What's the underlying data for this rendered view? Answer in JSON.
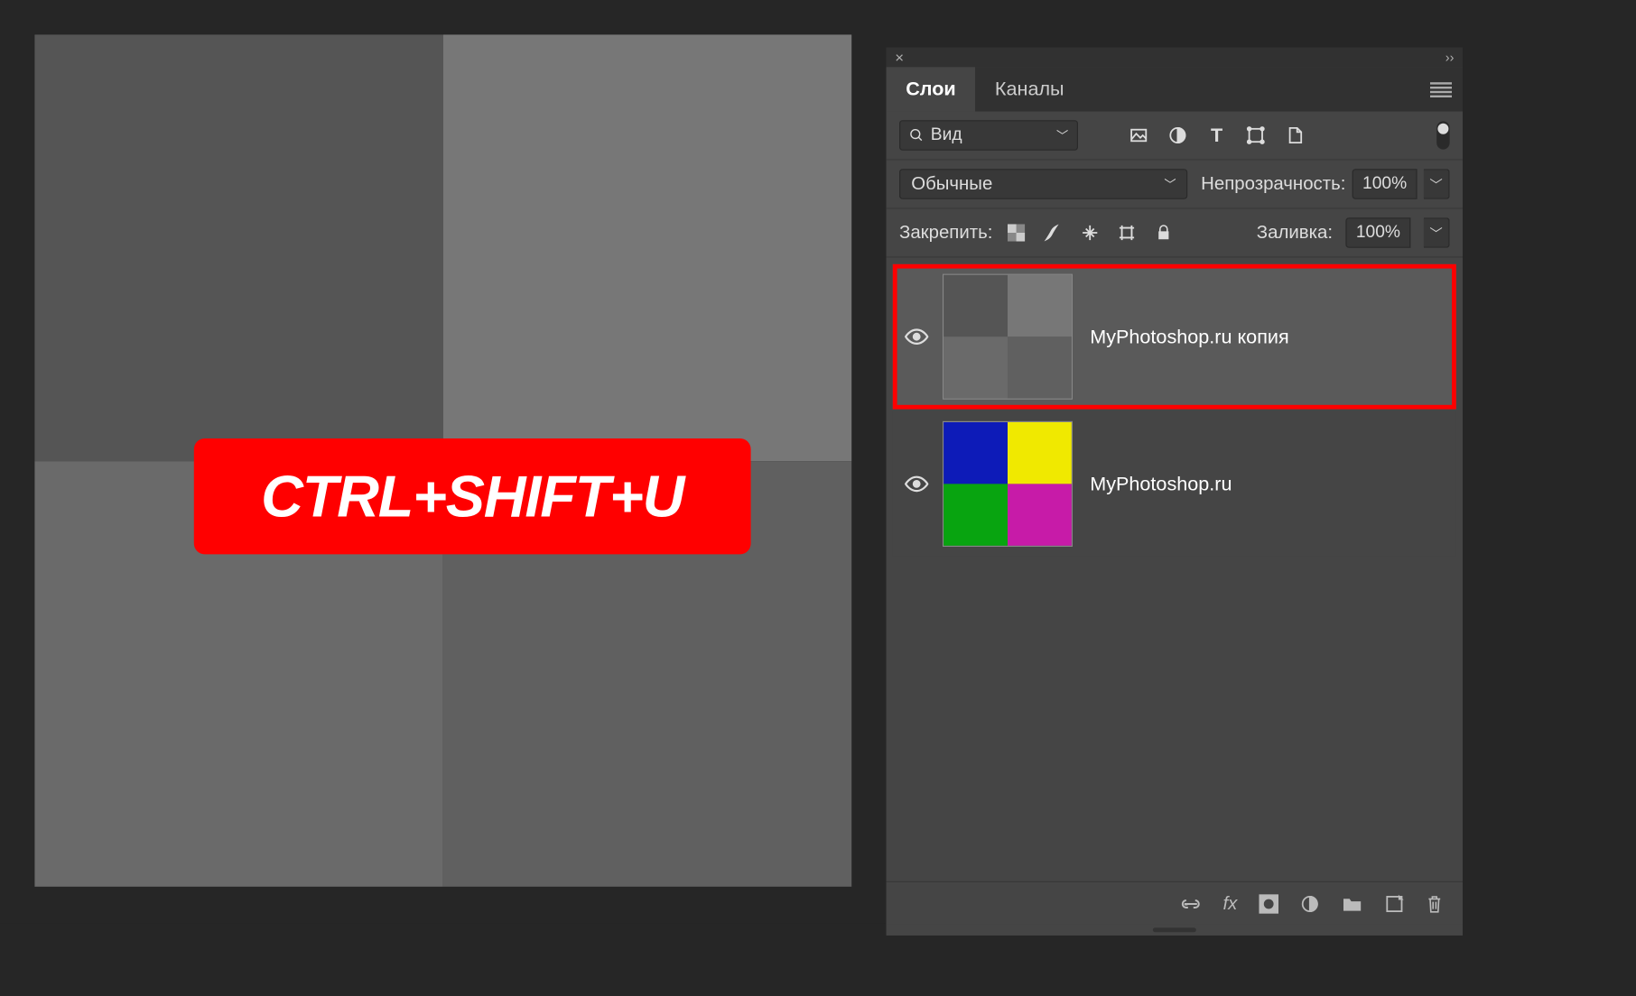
{
  "canvas": {
    "shortcut_text": "CTRL+SHIFT+U",
    "quads": {
      "tl": "#555555",
      "tr": "#777777",
      "bl": "#6a6a6a",
      "br": "#606060"
    }
  },
  "panel": {
    "tabs": {
      "layers": "Слои",
      "channels": "Каналы"
    },
    "filter": {
      "search_icon": "search-icon",
      "label": "Вид",
      "type_icons": [
        "image-filter-icon",
        "adjustment-filter-icon",
        "type-filter-icon",
        "shape-filter-icon",
        "smartobject-filter-icon"
      ]
    },
    "blend_mode": "Обычные",
    "opacity_label": "Непрозрачность:",
    "opacity_value": "100%",
    "lock_label": "Закрепить:",
    "fill_label": "Заливка:",
    "fill_value": "100%",
    "layers": [
      {
        "name": "MyPhotoshop.ru копия",
        "selected": true,
        "thumb": {
          "tl": "#555555",
          "tr": "#777777",
          "bl": "#6a6a6a",
          "br": "#606060"
        }
      },
      {
        "name": "MyPhotoshop.ru",
        "selected": false,
        "thumb": {
          "tl": "#0d1bb8",
          "tr": "#f0e900",
          "bl": "#08a410",
          "br": "#c71ba8"
        }
      }
    ],
    "footer_icons": [
      "link-icon",
      "fx-icon",
      "mask-icon",
      "adjustment-icon",
      "group-icon",
      "new-layer-icon",
      "trash-icon"
    ]
  }
}
